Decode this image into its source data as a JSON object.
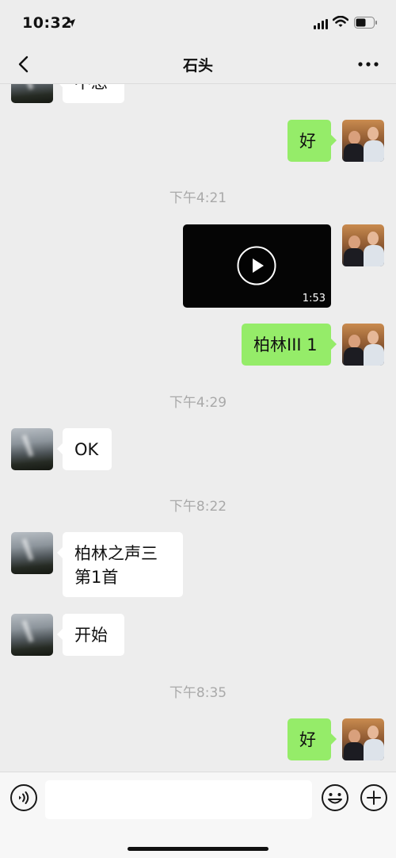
{
  "status_bar": {
    "time": "10:32"
  },
  "nav": {
    "title": "石头"
  },
  "messages": {
    "m0_text": "不急",
    "m1_text": "好",
    "ts1": "下午4:21",
    "video_duration": "1:53",
    "m3_text": "柏林III 1",
    "ts2": "下午4:29",
    "m4_text": "OK",
    "ts3": "下午8:22",
    "m5_line1": "柏林之声三",
    "m5_line2": "第1首",
    "m6_text": "开始",
    "ts4": "下午8:35",
    "m7_text": "好"
  },
  "input_bar": {
    "placeholder": ""
  },
  "colors": {
    "self_bubble": "#95ec69",
    "other_bubble": "#ffffff",
    "background": "#ededed"
  }
}
